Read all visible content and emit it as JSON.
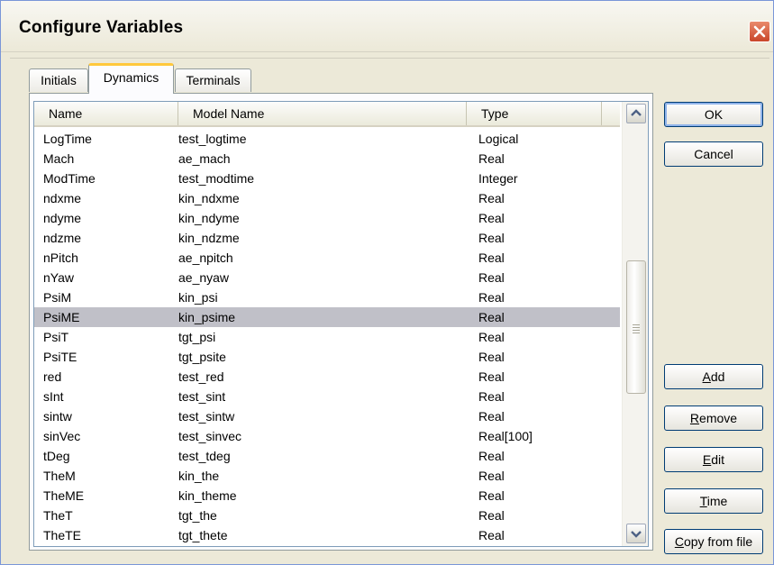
{
  "window": {
    "title": "Configure Variables"
  },
  "tabs": [
    {
      "label": "Initials"
    },
    {
      "label": "Dynamics"
    },
    {
      "label": "Terminals"
    }
  ],
  "table": {
    "columns": [
      "Name",
      "Model Name",
      "Type"
    ],
    "rows": [
      [
        "LogTime",
        "test_logtime",
        "Logical"
      ],
      [
        "Mach",
        "ae_mach",
        "Real"
      ],
      [
        "ModTime",
        "test_modtime",
        "Integer"
      ],
      [
        "ndxme",
        "kin_ndxme",
        "Real"
      ],
      [
        "ndyme",
        "kin_ndyme",
        "Real"
      ],
      [
        "ndzme",
        "kin_ndzme",
        "Real"
      ],
      [
        "nPitch",
        "ae_npitch",
        "Real"
      ],
      [
        "nYaw",
        "ae_nyaw",
        "Real"
      ],
      [
        "PsiM",
        "kin_psi",
        "Real"
      ],
      [
        "PsiME",
        "kin_psime",
        "Real"
      ],
      [
        "PsiT",
        "tgt_psi",
        "Real"
      ],
      [
        "PsiTE",
        "tgt_psite",
        "Real"
      ],
      [
        "red",
        "test_red",
        "Real"
      ],
      [
        "sInt",
        "test_sint",
        "Real"
      ],
      [
        "sintw",
        "test_sintw",
        "Real"
      ],
      [
        "sinVec",
        "test_sinvec",
        "Real[100]"
      ],
      [
        "tDeg",
        "test_tdeg",
        "Real"
      ],
      [
        "TheM",
        "kin_the",
        "Real"
      ],
      [
        "TheME",
        "kin_theme",
        "Real"
      ],
      [
        "TheT",
        "tgt_the",
        "Real"
      ],
      [
        "TheTE",
        "tgt_thete",
        "Real"
      ]
    ],
    "selected_row": "PsiME"
  },
  "buttons": {
    "ok": "OK",
    "cancel": "Cancel",
    "add_mnemonic": "A",
    "add_rest": "dd",
    "remove_mnemonic": "R",
    "remove_rest": "emove",
    "edit_mnemonic": "E",
    "edit_rest": "dit",
    "time_mnemonic": "T",
    "time_rest": "ime",
    "copy_from_file_mnemonic": "C",
    "copy_from_file_rest": "opy from file"
  },
  "colors": {
    "dialog_bg": "#ece9d8",
    "selected_row_bg": "#c0c0c8",
    "close_button": "#c9462a",
    "active_tab_accent": "#ffc83c"
  }
}
